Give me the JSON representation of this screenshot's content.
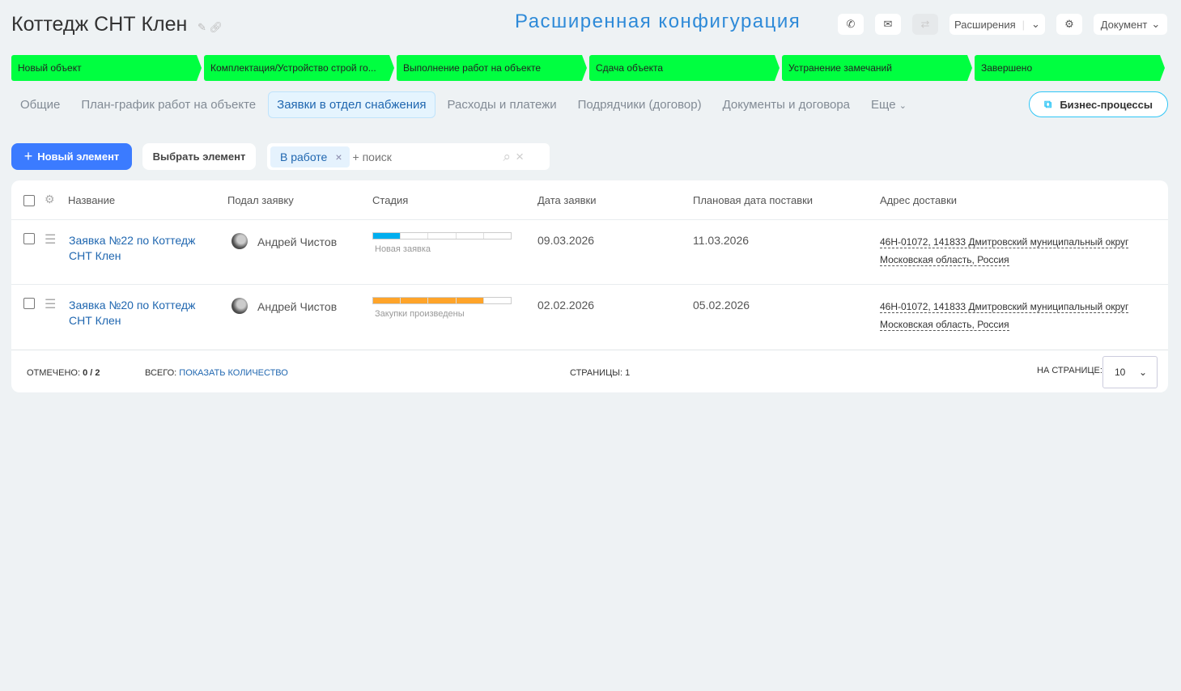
{
  "header": {
    "title": "Коттедж СНТ Клен",
    "config_label": "Расширенная конфигурация",
    "extensions_label": "Расширения",
    "document_label": "Документ"
  },
  "stages": [
    "Новый объект",
    "Комплектация/Устройство строй го...",
    "Выполнение работ на объекте",
    "Сдача объекта",
    "Устранение замечаний",
    "Завершено"
  ],
  "stage_color": "#00ff40",
  "tabs": [
    "Общие",
    "План-график работ на объекте",
    "Заявки в отдел снабжения",
    "Расходы и платежи",
    "Подрядчики (договор)",
    "Документы и договора",
    "Еще"
  ],
  "active_tab": 2,
  "business_processes": "Бизнес-процессы",
  "toolbar": {
    "new_label": "Новый элемент",
    "select_label": "Выбрать элемент",
    "filter_chip": "В работе",
    "search_placeholder": "+ поиск"
  },
  "table": {
    "headers": [
      "Название",
      "Подал заявку",
      "Стадия",
      "Дата заявки",
      "Плановая дата поставки",
      "Адрес доставки"
    ],
    "rows": [
      {
        "name_line1": "Заявка №22 по Коттедж",
        "name_line2": "СНТ Клен",
        "author": "Андрей Чистов",
        "stage": "Новая заявка",
        "stage_progress": 0.2,
        "stage_color": "#00aeef",
        "date": "09.03.2026",
        "planned": "11.03.2026",
        "addr1": "46Н-01072, 141833 Дмитровский муниципальный округ",
        "addr2": "Московская область, Россия"
      },
      {
        "name_line1": "Заявка №20 по Коттедж",
        "name_line2": "СНТ Клен",
        "author": "Андрей Чистов",
        "stage": "Закупки произведены",
        "stage_progress": 0.8,
        "stage_color": "#ffa42a",
        "date": "02.02.2026",
        "planned": "05.02.2026",
        "addr1": "46Н-01072, 141833 Дмитровский муниципальный округ",
        "addr2": "Московская область, Россия"
      }
    ]
  },
  "footer": {
    "selected_label": "ОТМЕЧЕНО:",
    "selected_value": "0 / 2",
    "total_label": "ВСЕГО:",
    "total_link": "ПОКАЗАТЬ КОЛИЧЕСТВО",
    "pages_label": "СТРАНИЦЫ: 1",
    "per_page_label": "НА СТРАНИЦЕ:",
    "per_page_value": "10"
  }
}
